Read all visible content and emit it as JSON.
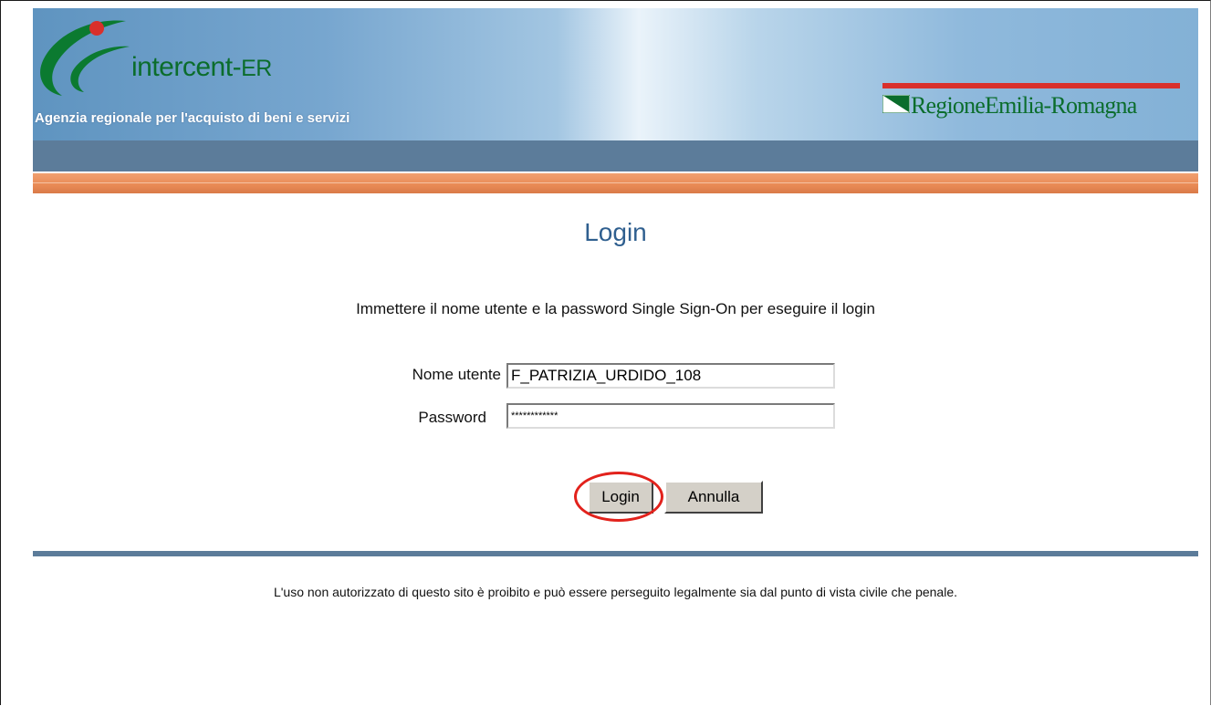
{
  "header": {
    "logo_name": "intercent-",
    "logo_suffix": "ER",
    "tagline": "Agenzia regionale per l'acquisto di beni e servizi",
    "region_name": "RegioneEmilia-Romagna"
  },
  "login": {
    "title": "Login",
    "instructions": "Immettere il nome utente e la password Single Sign-On per eseguire il login",
    "username_label": "Nome utente",
    "username_value": "F_PATRIZIA_URDIDO_108",
    "password_label": "Password",
    "password_value": "************",
    "login_button": "Login",
    "cancel_button": "Annulla"
  },
  "footer": {
    "disclaimer": "L'uso non autorizzato di questo sito è proibito e può essere perseguito legalmente sia dal punto di vista civile che penale."
  },
  "colors": {
    "brand_green": "#0b6d2c",
    "nav_blue": "#5c7c9a",
    "accent_orange": "#e98a55",
    "title_blue": "#2f5f8f",
    "highlight_red": "#e2221c"
  }
}
